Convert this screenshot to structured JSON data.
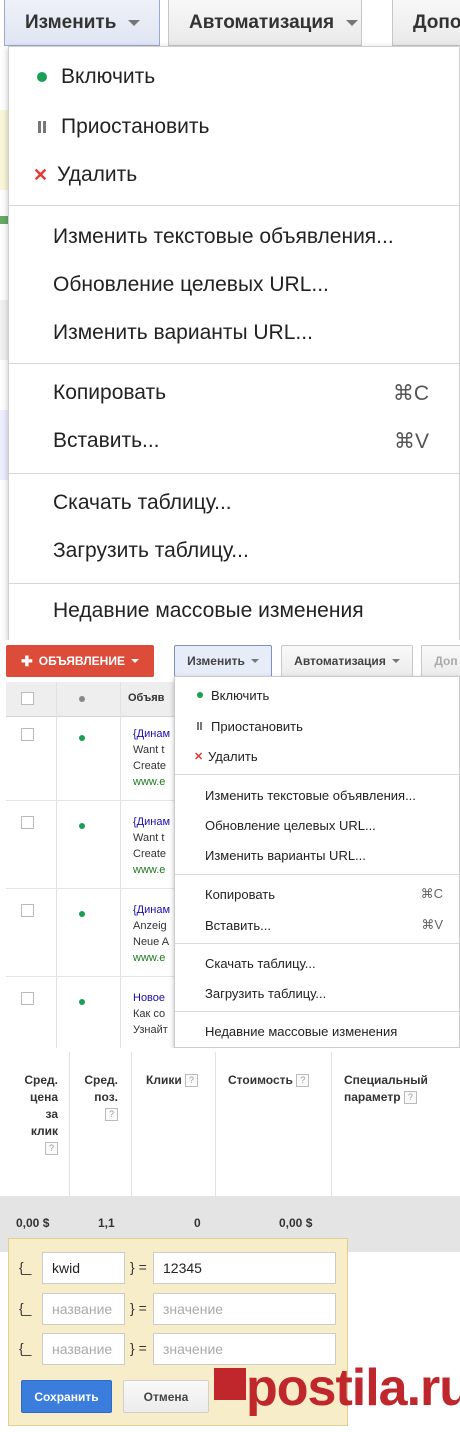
{
  "panel1": {
    "toolbar": {
      "edit": "Изменить",
      "automation": "Автоматизация",
      "more": "Допо"
    },
    "menu": {
      "enable": "Включить",
      "pause": "Приостановить",
      "delete": "Удалить",
      "edit_text_ads": "Изменить текстовые объявления...",
      "update_final_urls": "Обновление целевых URL...",
      "edit_url_options": "Изменить варианты URL...",
      "copy": "Копировать",
      "copy_shortcut": "⌘C",
      "paste": "Вставить...",
      "paste_shortcut": "⌘V",
      "download": "Скачать таблицу...",
      "upload": "Загрузить таблицу...",
      "recent_bulk": "Недавние массовые изменения"
    }
  },
  "panel2": {
    "ad_button": "ОБЪЯВЛЕНИЕ",
    "toolbar": {
      "edit": "Изменить",
      "automation": "Автоматизация",
      "more": "Доп"
    },
    "table_header": "Объяв",
    "rows": [
      {
        "title": "{Динам",
        "line1": "Want t",
        "line2": "Create",
        "url": "www.e"
      },
      {
        "title": "{Динам",
        "line1": "Want t",
        "line2": "Create",
        "url": "www.e"
      },
      {
        "title": "{Динам",
        "line1": "Anzeig",
        "line2": "Neue A",
        "url": "www.e"
      },
      {
        "title": "Новое",
        "line1": "Как со",
        "line2": "Узнайт",
        "url": ""
      }
    ],
    "menu": {
      "enable": "Включить",
      "pause": "Приостановить",
      "delete": "Удалить",
      "edit_text_ads": "Изменить текстовые объявления...",
      "update_final_urls": "Обновление целевых URL...",
      "edit_url_options": "Изменить варианты URL...",
      "copy": "Копировать",
      "copy_shortcut": "⌘C",
      "paste": "Вставить...",
      "paste_shortcut": "⌘V",
      "download": "Скачать таблицу...",
      "upload": "Загрузить таблицу...",
      "recent_bulk": "Недавние массовые изменения"
    }
  },
  "panel3": {
    "columns": {
      "avg_cpc": [
        "Сред.",
        "цена",
        "за",
        "клик"
      ],
      "avg_pos": [
        "Сред.",
        "поз."
      ],
      "clicks": "Клики",
      "cost": "Стоимость",
      "custom": [
        "Специальный",
        "параметр"
      ],
      "help": "?"
    },
    "totals": {
      "avg_cpc": "0,00 $",
      "avg_pos": "1,1",
      "clicks": "0",
      "cost": "0,00 $"
    },
    "editor": {
      "brace_open": "{_",
      "brace_close": "} =",
      "rows": [
        {
          "name": "kwid",
          "value": "12345"
        },
        {
          "name_placeholder": "название",
          "value_placeholder": "значение"
        },
        {
          "name_placeholder": "название",
          "value_placeholder": "значение"
        }
      ],
      "save": "Сохранить",
      "cancel": "Отмена"
    }
  },
  "watermark": "postila.ru"
}
